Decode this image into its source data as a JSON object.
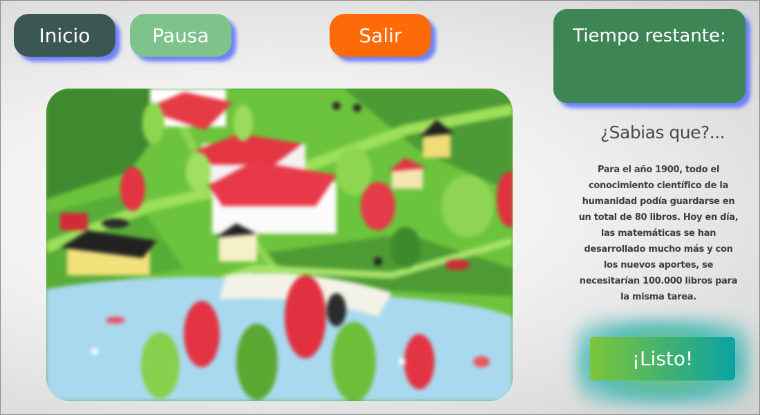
{
  "toolbar": {
    "start_label": "Inicio",
    "pause_label": "Pausa",
    "exit_label": "Salir"
  },
  "timer": {
    "label": "Tiempo restante:",
    "value": ""
  },
  "fact": {
    "title": "¿Sabias que?...",
    "body": "Para el año 1900, todo el conocimiento científico de la humanidad podía guardarse en un total de 80 libros. Hoy en día, las matemáticas se han desarrollado mucho más y con los nuevos aportes, se necesitarían 100.000 libros para la misma tarea."
  },
  "ready_button": {
    "label": "¡Listo!"
  },
  "colors": {
    "start_button": "#3b5752",
    "pause_button": "#7ec28c",
    "exit_button": "#fe6a08",
    "timer_panel": "#3d8554",
    "button_shadow": "#465fff"
  },
  "scene": {
    "description_icon": "village-lake-illustration"
  }
}
